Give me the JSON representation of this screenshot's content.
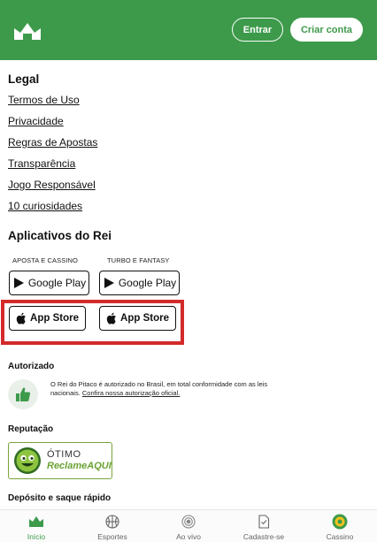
{
  "header": {
    "login_label": "Entrar",
    "signup_label": "Criar conta"
  },
  "legal": {
    "title": "Legal",
    "links": [
      "Termos de Uso",
      "Privacidade",
      "Regras de Apostas",
      "Transparência",
      "Jogo Responsável",
      "10 curiosidades"
    ]
  },
  "apps": {
    "title": "Aplicativos do Rei",
    "col1_label": "APOSTA E CASSINO",
    "col2_label": "TURBO E FANTASY",
    "google_play": "Google Play",
    "app_store": "App Store"
  },
  "authorized": {
    "title": "Autorizado",
    "text": "O Rei do Pitaco é autorizado no Brasil, em total conformidade com as leis nacionais.",
    "link": "Confira nossa autorização oficial."
  },
  "reputation": {
    "title": "Reputação",
    "rating": "ÓTIMO",
    "brand": "ReclameAQUI"
  },
  "payments": {
    "title": "Depósito e saque rápido"
  },
  "bottom_nav": {
    "items": [
      {
        "label": "Início",
        "icon": "crown-icon",
        "active": true
      },
      {
        "label": "Esportes",
        "icon": "basketball-icon",
        "active": false
      },
      {
        "label": "Ao vivo",
        "icon": "live-icon",
        "active": false
      },
      {
        "label": "Cadastre-se",
        "icon": "signup-icon",
        "active": false
      },
      {
        "label": "Cassino",
        "icon": "casino-icon",
        "active": false
      }
    ]
  },
  "colors": {
    "brand_green": "#3d9a4b",
    "highlight_red": "#d32a2a"
  }
}
